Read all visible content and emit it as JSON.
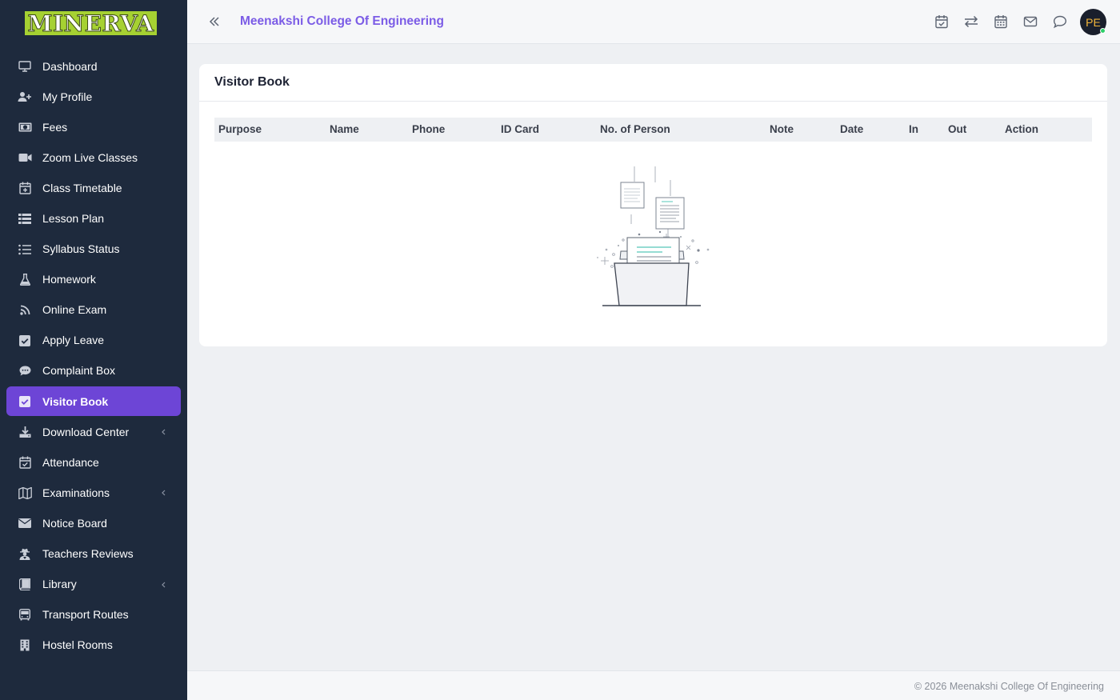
{
  "brand": {
    "logo_text": "MINERVA",
    "logo_bg": "#a6d132"
  },
  "sidebar": {
    "items": [
      {
        "label": "Dashboard",
        "icon": "monitor-icon"
      },
      {
        "label": "My Profile",
        "icon": "user-plus-icon"
      },
      {
        "label": "Fees",
        "icon": "money-icon"
      },
      {
        "label": "Zoom Live Classes",
        "icon": "video-icon"
      },
      {
        "label": "Class Timetable",
        "icon": "calendar-plus-icon"
      },
      {
        "label": "Lesson Plan",
        "icon": "list-icon"
      },
      {
        "label": "Syllabus Status",
        "icon": "list-ol-icon"
      },
      {
        "label": "Homework",
        "icon": "flask-icon"
      },
      {
        "label": "Online Exam",
        "icon": "rss-icon"
      },
      {
        "label": "Apply Leave",
        "icon": "check-square-icon"
      },
      {
        "label": "Complaint Box",
        "icon": "comment-icon"
      },
      {
        "label": "Visitor Book",
        "icon": "check-square-icon",
        "active": true
      },
      {
        "label": "Download Center",
        "icon": "download-icon",
        "has_submenu": true
      },
      {
        "label": "Attendance",
        "icon": "calendar-check-icon"
      },
      {
        "label": "Examinations",
        "icon": "map-icon",
        "has_submenu": true
      },
      {
        "label": "Notice Board",
        "icon": "envelope-icon"
      },
      {
        "label": "Teachers Reviews",
        "icon": "user-secret-icon"
      },
      {
        "label": "Library",
        "icon": "book-icon",
        "has_submenu": true
      },
      {
        "label": "Transport Routes",
        "icon": "bus-icon"
      },
      {
        "label": "Hostel Rooms",
        "icon": "building-icon"
      }
    ],
    "active_color": "#6d45d6"
  },
  "header": {
    "college_name": "Meenakshi College Of Engineering",
    "icons": [
      "calendar-check-icon",
      "exchange-icon",
      "calendar-icon",
      "mail-icon",
      "chat-icon"
    ],
    "avatar_initials": "PE"
  },
  "visitor_book": {
    "title": "Visitor Book",
    "columns": [
      "Purpose",
      "Name",
      "Phone",
      "ID Card",
      "No. of Person",
      "Note",
      "Date",
      "In",
      "Out",
      "Action"
    ],
    "rows": []
  },
  "footer": {
    "copyright": "© 2026 Meenakshi College Of Engineering"
  }
}
